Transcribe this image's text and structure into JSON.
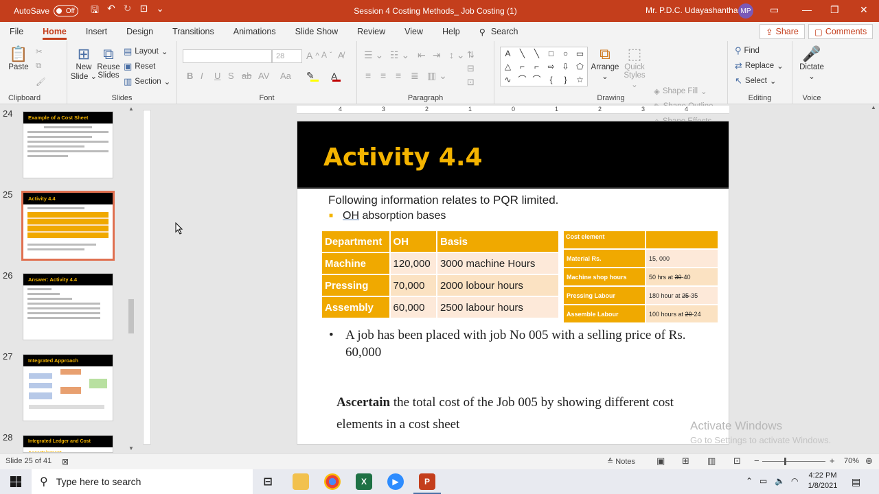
{
  "titlebar": {
    "autosave_label": "AutoSave",
    "autosave_state": "Off",
    "doc_title": "Session  4  Costing Methods_ Job Costing (1)",
    "user": "Mr. P.D.C. Udayashantha",
    "initials": "MP"
  },
  "tabs": [
    "File",
    "Home",
    "Insert",
    "Design",
    "Transitions",
    "Animations",
    "Slide Show",
    "Review",
    "View",
    "Help"
  ],
  "active_tab": "Home",
  "search_label": "Search",
  "share_label": "Share",
  "comments_label": "Comments",
  "ribbon": {
    "clipboard": {
      "paste": "Paste",
      "label": "Clipboard"
    },
    "slides": {
      "new_slide": "New\nSlide",
      "new_slide_l1": "New",
      "new_slide_l2": "Slide",
      "reuse_l1": "Reuse",
      "reuse_l2": "Slides",
      "layout": "Layout",
      "reset": "Reset",
      "section": "Section",
      "label": "Slides"
    },
    "font": {
      "size": "28",
      "label": "Font",
      "bold": "B",
      "italic": "I",
      "underline": "U",
      "strike": "S"
    },
    "paragraph": {
      "label": "Paragraph"
    },
    "drawing": {
      "arrange": "Arrange",
      "quick_l1": "Quick",
      "quick_l2": "Styles",
      "shape_fill": "Shape Fill",
      "shape_outline": "Shape Outline",
      "shape_effects": "Shape Effects",
      "label": "Drawing"
    },
    "editing": {
      "find": "Find",
      "replace": "Replace",
      "select": "Select",
      "label": "Editing"
    },
    "voice": {
      "dictate": "Dictate",
      "label": "Voice"
    }
  },
  "slides_panel": {
    "slides": [
      {
        "num": "24",
        "title": "Example of a Cost Sheet"
      },
      {
        "num": "25",
        "title": "Activity 4.4"
      },
      {
        "num": "26",
        "title": "Answer: Activity 4.4"
      },
      {
        "num": "27",
        "title": "Integrated Approach"
      },
      {
        "num": "28",
        "title": "Integrated Ledger and Cost Ascertainment"
      }
    ]
  },
  "ruler": [
    "4",
    "3",
    "2",
    "1",
    "0",
    "1",
    "2",
    "3",
    "4"
  ],
  "slide": {
    "title": "Activity 4.4",
    "intro": "Following information relates to PQR limited.",
    "bullet_oh_first": "OH",
    "bullet_oh_rest": " absorption bases",
    "table1": {
      "headers": [
        "Department",
        "OH",
        "Basis"
      ],
      "rows": [
        [
          "Machine",
          "120,000",
          "3000 machine Hours"
        ],
        [
          "Pressing",
          "70,000",
          "2000 lobour hours"
        ],
        [
          "Assembly",
          "60,000",
          "2500 labour hours"
        ]
      ]
    },
    "table2": {
      "header": "Cost element",
      "rows": [
        {
          "element": "Material  Rs.",
          "value_main": "15, 000",
          "value_strike": ""
        },
        {
          "element": "Machine shop hours",
          "value_main": "50 hrs at ",
          "value_strike": "30",
          "value_tail": "-40"
        },
        {
          "element": "Pressing Labour",
          "value_main": "180 hour at ",
          "value_strike": "25",
          "value_tail": "-35"
        },
        {
          "element": "Assemble Labour",
          "value_main": "100 hours at ",
          "value_strike": "20",
          "value_tail": "-24"
        }
      ]
    },
    "job_bullet": "A job has been placed with job No 005 with a selling price of Rs. 60,000",
    "ascertain_bold": "Ascertain",
    "ascertain_rest": " the total cost of the Job 005 by showing different cost elements in a cost sheet"
  },
  "watermark": {
    "line1": "Activate Windows",
    "line2": "Go to Settings to activate Windows."
  },
  "status": {
    "slide_info": "Slide 25 of 41",
    "notes": "Notes",
    "zoom": "70%"
  },
  "taskbar": {
    "search_placeholder": "Type here to search",
    "time": "4:22 PM",
    "date": "1/8/2021"
  },
  "colors": {
    "accent": "#c43e1c",
    "orange": "#f0a900",
    "title_yellow": "#f4b400",
    "light_peach": "#fde9d9"
  }
}
